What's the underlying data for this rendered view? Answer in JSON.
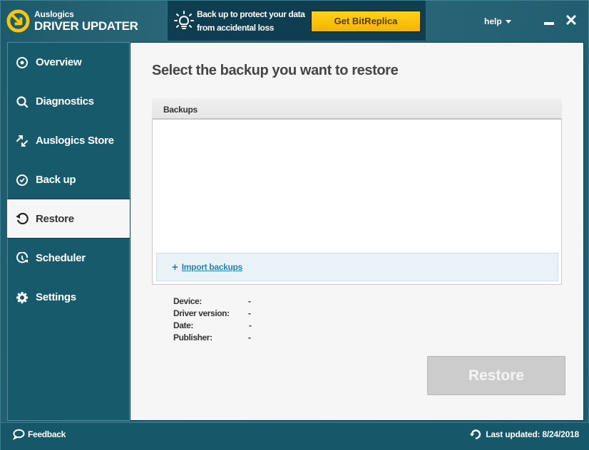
{
  "app": {
    "brand_small": "Auslogics",
    "brand_big": "DRIVER UPDATER"
  },
  "promo": {
    "icon": "lightbulb-icon",
    "line1": "Back up to protect your data",
    "line2": "from accidental loss",
    "button_label": "Get BitReplica",
    "button_color": "#f8c10a"
  },
  "window_controls": {
    "help_label": "help",
    "minimize_icon": "minimize-icon",
    "close_icon": "close-icon",
    "close_glyph": "✕"
  },
  "sidebar": {
    "active": "Restore",
    "items": [
      {
        "label": "Overview",
        "icon": "target-icon"
      },
      {
        "label": "Diagnostics",
        "icon": "search-icon"
      },
      {
        "label": "Auslogics Store",
        "icon": "arrows-icon"
      },
      {
        "label": "Back up",
        "icon": "check-circle-icon"
      },
      {
        "label": "Restore",
        "icon": "restore-icon"
      },
      {
        "label": "Scheduler",
        "icon": "clock-icon"
      },
      {
        "label": "Settings",
        "icon": "gear-icon"
      }
    ]
  },
  "main": {
    "title": "Select the backup you want to restore",
    "backups_header": "Backups",
    "backups": [],
    "import_label": "Import backups",
    "details": [
      {
        "label": "Device:",
        "value": "-"
      },
      {
        "label": "Driver version:",
        "value": "-"
      },
      {
        "label": "Date:",
        "value": "-"
      },
      {
        "label": "Publisher:",
        "value": "-"
      }
    ],
    "restore_button": "Restore",
    "restore_enabled": false
  },
  "footer": {
    "feedback_label": "Feedback",
    "last_updated": "Last updated: 8/24/2018"
  },
  "colors": {
    "frame": "#16586a",
    "promo_bg": "#0f3e50",
    "content_bg": "#f6f6f6",
    "link": "#2682b4",
    "import_bg": "#e8f2f7"
  }
}
